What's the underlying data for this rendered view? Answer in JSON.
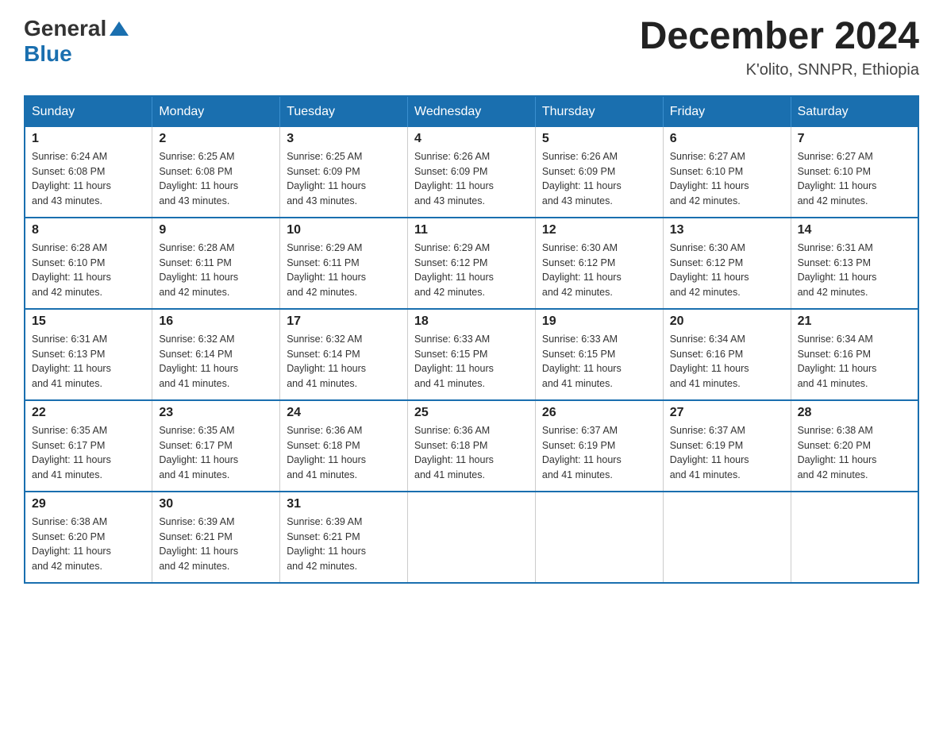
{
  "header": {
    "logo_general": "General",
    "logo_blue": "Blue",
    "month_year": "December 2024",
    "location": "K'olito, SNNPR, Ethiopia"
  },
  "days_of_week": [
    "Sunday",
    "Monday",
    "Tuesday",
    "Wednesday",
    "Thursday",
    "Friday",
    "Saturday"
  ],
  "weeks": [
    [
      {
        "day": "1",
        "sunrise": "6:24 AM",
        "sunset": "6:08 PM",
        "daylight": "11 hours and 43 minutes."
      },
      {
        "day": "2",
        "sunrise": "6:25 AM",
        "sunset": "6:08 PM",
        "daylight": "11 hours and 43 minutes."
      },
      {
        "day": "3",
        "sunrise": "6:25 AM",
        "sunset": "6:09 PM",
        "daylight": "11 hours and 43 minutes."
      },
      {
        "day": "4",
        "sunrise": "6:26 AM",
        "sunset": "6:09 PM",
        "daylight": "11 hours and 43 minutes."
      },
      {
        "day": "5",
        "sunrise": "6:26 AM",
        "sunset": "6:09 PM",
        "daylight": "11 hours and 43 minutes."
      },
      {
        "day": "6",
        "sunrise": "6:27 AM",
        "sunset": "6:10 PM",
        "daylight": "11 hours and 42 minutes."
      },
      {
        "day": "7",
        "sunrise": "6:27 AM",
        "sunset": "6:10 PM",
        "daylight": "11 hours and 42 minutes."
      }
    ],
    [
      {
        "day": "8",
        "sunrise": "6:28 AM",
        "sunset": "6:10 PM",
        "daylight": "11 hours and 42 minutes."
      },
      {
        "day": "9",
        "sunrise": "6:28 AM",
        "sunset": "6:11 PM",
        "daylight": "11 hours and 42 minutes."
      },
      {
        "day": "10",
        "sunrise": "6:29 AM",
        "sunset": "6:11 PM",
        "daylight": "11 hours and 42 minutes."
      },
      {
        "day": "11",
        "sunrise": "6:29 AM",
        "sunset": "6:12 PM",
        "daylight": "11 hours and 42 minutes."
      },
      {
        "day": "12",
        "sunrise": "6:30 AM",
        "sunset": "6:12 PM",
        "daylight": "11 hours and 42 minutes."
      },
      {
        "day": "13",
        "sunrise": "6:30 AM",
        "sunset": "6:12 PM",
        "daylight": "11 hours and 42 minutes."
      },
      {
        "day": "14",
        "sunrise": "6:31 AM",
        "sunset": "6:13 PM",
        "daylight": "11 hours and 42 minutes."
      }
    ],
    [
      {
        "day": "15",
        "sunrise": "6:31 AM",
        "sunset": "6:13 PM",
        "daylight": "11 hours and 41 minutes."
      },
      {
        "day": "16",
        "sunrise": "6:32 AM",
        "sunset": "6:14 PM",
        "daylight": "11 hours and 41 minutes."
      },
      {
        "day": "17",
        "sunrise": "6:32 AM",
        "sunset": "6:14 PM",
        "daylight": "11 hours and 41 minutes."
      },
      {
        "day": "18",
        "sunrise": "6:33 AM",
        "sunset": "6:15 PM",
        "daylight": "11 hours and 41 minutes."
      },
      {
        "day": "19",
        "sunrise": "6:33 AM",
        "sunset": "6:15 PM",
        "daylight": "11 hours and 41 minutes."
      },
      {
        "day": "20",
        "sunrise": "6:34 AM",
        "sunset": "6:16 PM",
        "daylight": "11 hours and 41 minutes."
      },
      {
        "day": "21",
        "sunrise": "6:34 AM",
        "sunset": "6:16 PM",
        "daylight": "11 hours and 41 minutes."
      }
    ],
    [
      {
        "day": "22",
        "sunrise": "6:35 AM",
        "sunset": "6:17 PM",
        "daylight": "11 hours and 41 minutes."
      },
      {
        "day": "23",
        "sunrise": "6:35 AM",
        "sunset": "6:17 PM",
        "daylight": "11 hours and 41 minutes."
      },
      {
        "day": "24",
        "sunrise": "6:36 AM",
        "sunset": "6:18 PM",
        "daylight": "11 hours and 41 minutes."
      },
      {
        "day": "25",
        "sunrise": "6:36 AM",
        "sunset": "6:18 PM",
        "daylight": "11 hours and 41 minutes."
      },
      {
        "day": "26",
        "sunrise": "6:37 AM",
        "sunset": "6:19 PM",
        "daylight": "11 hours and 41 minutes."
      },
      {
        "day": "27",
        "sunrise": "6:37 AM",
        "sunset": "6:19 PM",
        "daylight": "11 hours and 41 minutes."
      },
      {
        "day": "28",
        "sunrise": "6:38 AM",
        "sunset": "6:20 PM",
        "daylight": "11 hours and 42 minutes."
      }
    ],
    [
      {
        "day": "29",
        "sunrise": "6:38 AM",
        "sunset": "6:20 PM",
        "daylight": "11 hours and 42 minutes."
      },
      {
        "day": "30",
        "sunrise": "6:39 AM",
        "sunset": "6:21 PM",
        "daylight": "11 hours and 42 minutes."
      },
      {
        "day": "31",
        "sunrise": "6:39 AM",
        "sunset": "6:21 PM",
        "daylight": "11 hours and 42 minutes."
      },
      null,
      null,
      null,
      null
    ]
  ],
  "labels": {
    "sunrise": "Sunrise:",
    "sunset": "Sunset:",
    "daylight": "Daylight:"
  }
}
